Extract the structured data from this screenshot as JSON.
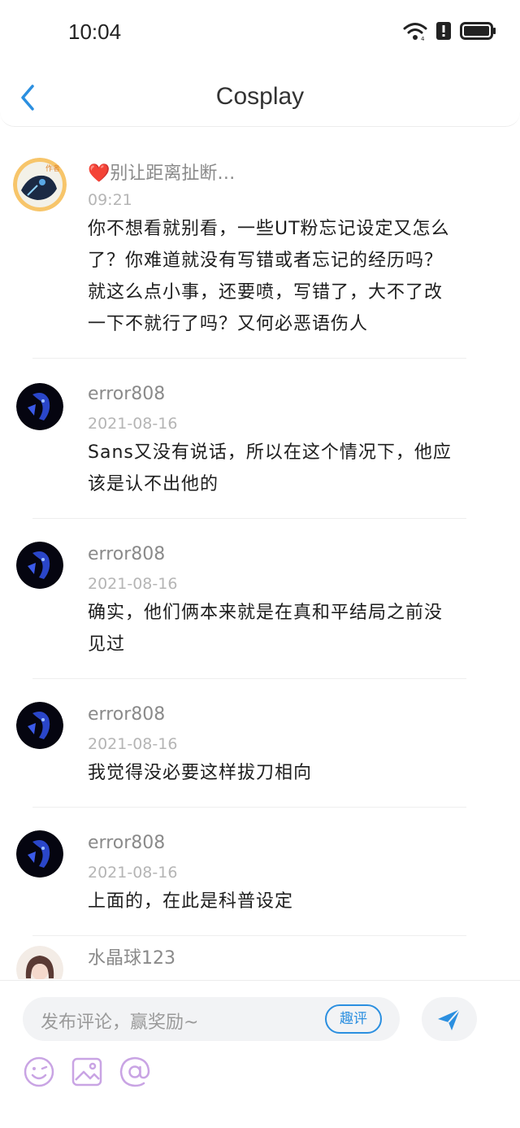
{
  "status_bar": {
    "time": "10:04"
  },
  "nav": {
    "title": "Cosplay"
  },
  "comments": [
    {
      "username": "❤️别让距离扯断…",
      "time": "09:21",
      "content_lines": [
        "你不想看就别看，一些UT粉忘记设定又怎么",
        "了？你难道就没有写错或者忘记的经历吗？",
        "就这么点小事，还要喷，写错了，大不了改",
        "一下不就行了吗？又何必恶语伤人"
      ],
      "author_badge": "作者"
    },
    {
      "username": "error808",
      "time": "2021-08-16",
      "content_lines": [
        "Sans又没有说话，所以在这个情况下，他应",
        "该是认不出他的"
      ]
    },
    {
      "username": "error808",
      "time": "2021-08-16",
      "content_lines": [
        "确实，他们俩本来就是在真和平结局之前没",
        "见过"
      ]
    },
    {
      "username": "error808",
      "time": "2021-08-16",
      "content_lines": [
        "我觉得没必要这样拔刀相向"
      ]
    },
    {
      "username": "error808",
      "time": "2021-08-16",
      "content_lines": [
        "上面的，在此是科普设定"
      ]
    },
    {
      "username": "水晶球123"
    }
  ],
  "composer": {
    "placeholder": "发布评论，赢奖励~",
    "qp_label": "趣评",
    "icons": [
      "emoji-icon",
      "image-icon",
      "at-icon",
      "send-icon"
    ]
  },
  "colors": {
    "accent": "#2b8fe0",
    "tool_purple": "#c9a4e4",
    "back_arrow": "#2b8fe0"
  }
}
